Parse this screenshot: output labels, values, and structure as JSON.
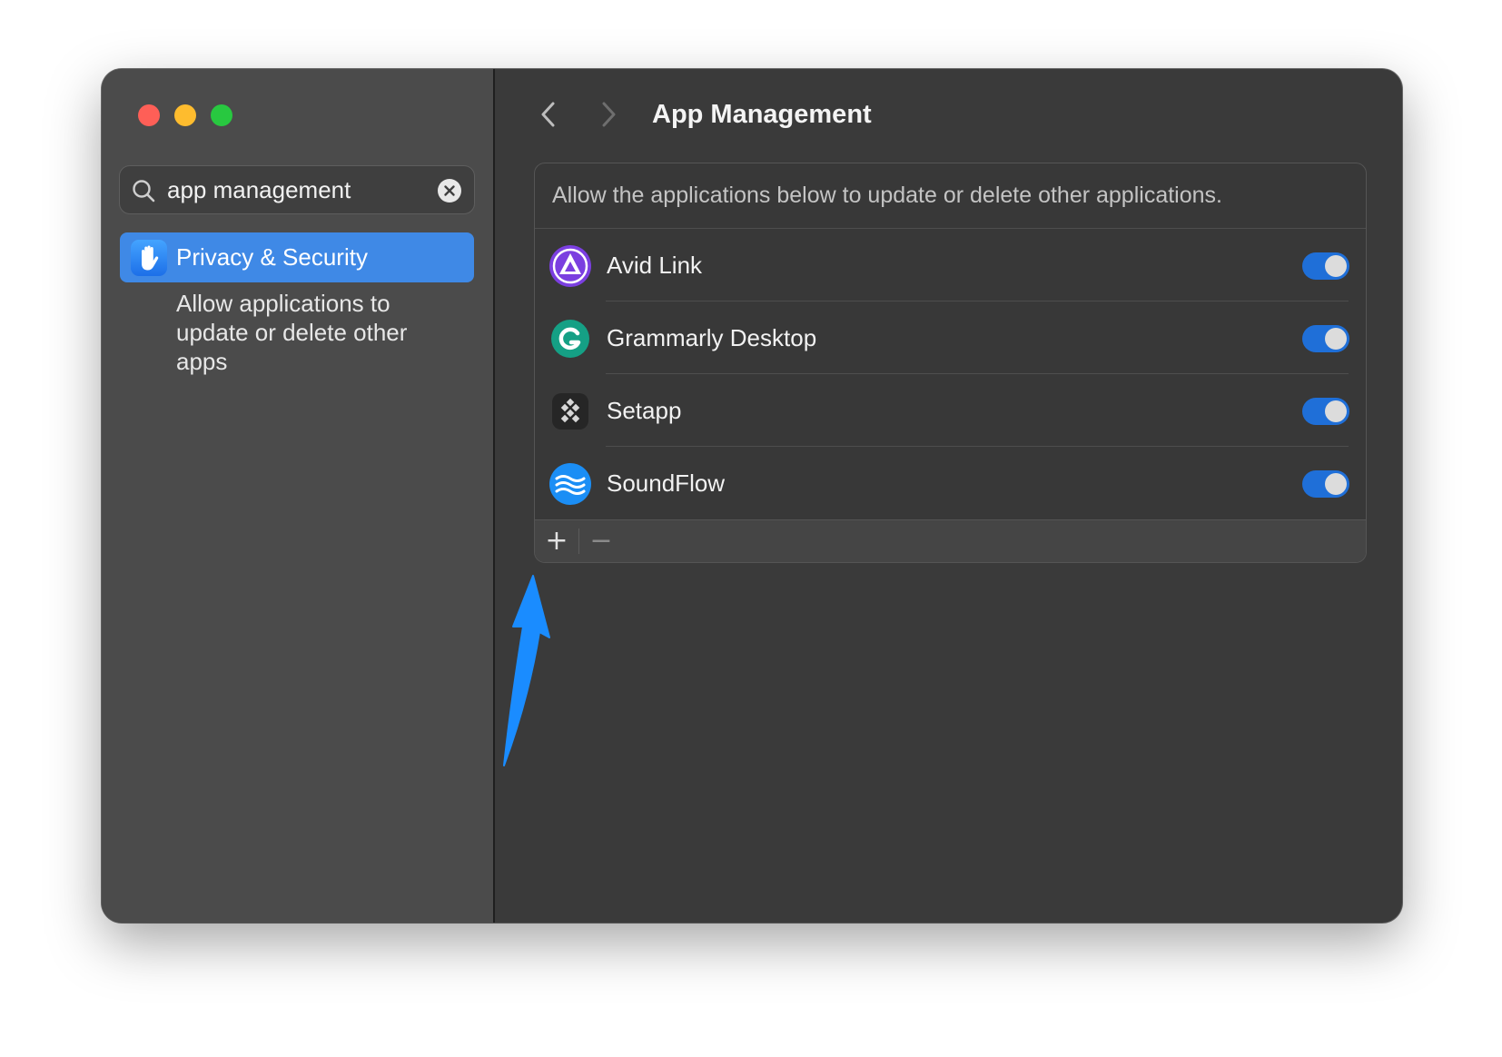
{
  "window": {
    "traffic_lights": [
      "close",
      "minimize",
      "zoom"
    ]
  },
  "sidebar": {
    "search": {
      "value": "app management",
      "icon": "search-icon",
      "clear_icon": "clear-icon"
    },
    "selected_item": {
      "label": "Privacy & Security",
      "icon": "hand-raised-icon",
      "description": "Allow applications to update or delete other apps"
    }
  },
  "main": {
    "title": "App Management",
    "back_icon": "chevron-left-icon",
    "forward_icon": "chevron-right-icon",
    "panel": {
      "description": "Allow the applications below to update or delete other applications.",
      "apps": [
        {
          "name": "Avid Link",
          "icon": "avid-link-icon",
          "enabled": true
        },
        {
          "name": "Grammarly Desktop",
          "icon": "grammarly-icon",
          "enabled": true
        },
        {
          "name": "Setapp",
          "icon": "setapp-icon",
          "enabled": true
        },
        {
          "name": "SoundFlow",
          "icon": "soundflow-icon",
          "enabled": true
        }
      ],
      "add_label": "+",
      "remove_label": "−"
    }
  },
  "annotation": {
    "arrow_color": "#1a8cff"
  },
  "colors": {
    "accent": "#3f89e6",
    "toggle_on": "#1f6fd8"
  }
}
